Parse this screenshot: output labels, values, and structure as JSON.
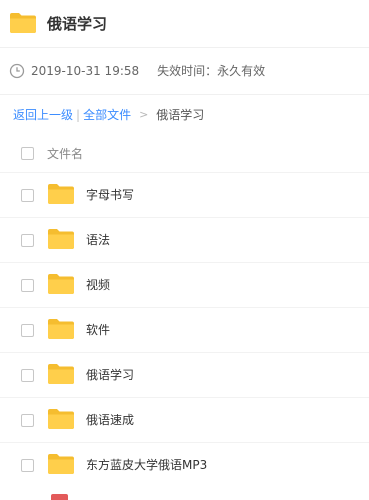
{
  "header": {
    "title": "俄语学习",
    "folder_icon": "folder-icon"
  },
  "meta": {
    "time_icon": "clock-icon",
    "time": "2019-10-31 19:58",
    "expire": "失效时间：永久有效"
  },
  "breadcrumb": {
    "back": "返回上一级",
    "sep": "|",
    "all_files": "全部文件",
    "arrow": ">",
    "current": "俄语学习"
  },
  "list": {
    "column_name": "文件名",
    "items": [
      {
        "name": "字母书写",
        "icon": "folder-icon"
      },
      {
        "name": "语法",
        "icon": "folder-icon"
      },
      {
        "name": "视频",
        "icon": "folder-icon"
      },
      {
        "name": "软件",
        "icon": "folder-icon"
      },
      {
        "name": "俄语学习",
        "icon": "folder-icon"
      },
      {
        "name": "俄语速成",
        "icon": "folder-icon"
      },
      {
        "name": "东方蓝皮大学俄语MP3",
        "icon": "folder-icon"
      }
    ]
  },
  "colors": {
    "folder": "#ffcf4b",
    "folder_tab": "#f5bd2f",
    "link": "#3b8cff",
    "partial_file": "#e35a5a"
  }
}
